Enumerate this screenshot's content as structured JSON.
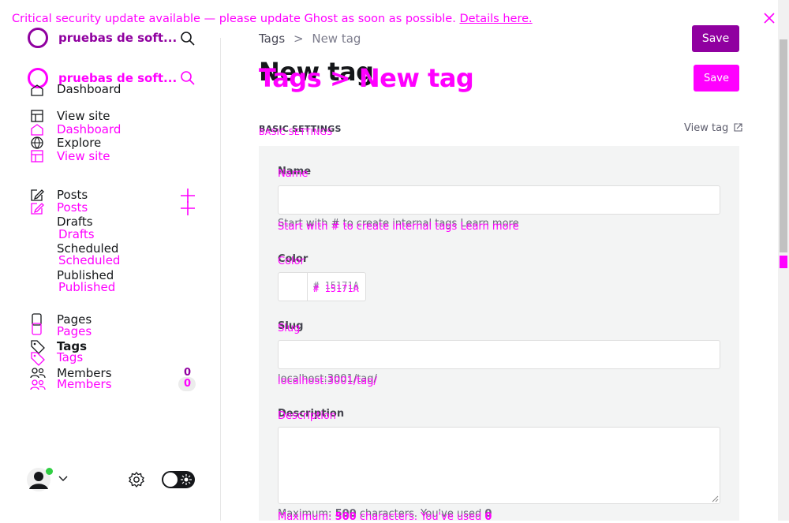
{
  "banner": {
    "text": "Critical security update available — please update Ghost as soon as possible.",
    "link": "Details here."
  },
  "site": {
    "title": "pruebas de soft..."
  },
  "sidebar": {
    "dashboard": "Dashboard",
    "view_site": "View site",
    "explore": "Explore",
    "posts": "Posts",
    "drafts": "Drafts",
    "scheduled": "Scheduled",
    "published": "Published",
    "pages": "Pages",
    "tags": "Tags",
    "members": "Members",
    "members_count": "0"
  },
  "header": {
    "crumb_parent": "Tags",
    "crumb_sep": ">",
    "crumb_current": "New tag",
    "title": "New tag",
    "title_dup": "Tags > New tag",
    "save": "Save"
  },
  "form": {
    "section": "BASIC SETTINGS",
    "view_tag": "View tag",
    "name_label": "Name",
    "name_hint": "Start with # to create internal tags Learn more",
    "color_label": "Color",
    "color_value": "15171A",
    "color_hash": "#",
    "slug_label": "Slug",
    "slug_hint": "localhost:3001/tag/",
    "description_label": "Description",
    "description_hint_prefix": "Maximum:",
    "description_max": "500",
    "description_hint_mid": "characters. You've used",
    "description_used": "0"
  },
  "colors": {
    "accent": "#9000a0",
    "accent_overlay": "#ff00ff",
    "online": "#30cf43",
    "panel_bg": "#f3f4f4"
  }
}
